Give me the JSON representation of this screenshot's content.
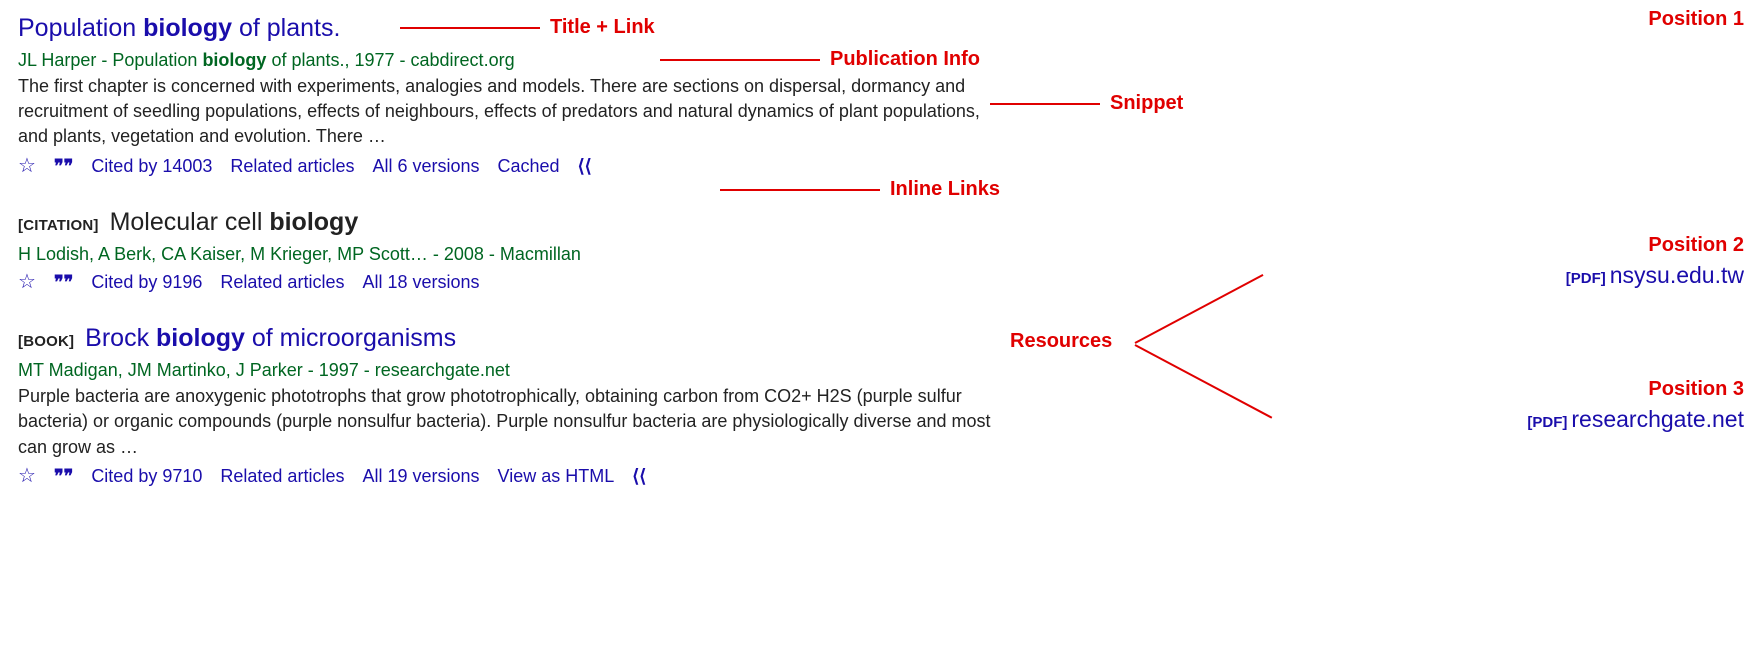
{
  "annotations": {
    "title_link": "Title + Link",
    "pub_info": "Publication Info",
    "snippet": "Snippet",
    "inline_links": "Inline Links",
    "resources": "Resources",
    "pos1": "Position 1",
    "pos2": "Position 2",
    "pos3": "Position 3"
  },
  "results": [
    {
      "title_pre": "Population ",
      "title_bold": "biology",
      "title_post": " of plants.",
      "pub_pre": "JL Harper - Population ",
      "pub_bold": "biology",
      "pub_post": " of plants., 1977 - cabdirect.org",
      "snippet": "The first chapter is concerned with experiments, analogies and models. There are sections on dispersal, dormancy and recruitment of seedling populations, effects of neighbours, effects of predators and natural dynamics of plant populations, and plants, vegetation and evolution. There …",
      "cited_by": "Cited by 14003",
      "related": "Related articles",
      "versions": "All 6 versions",
      "extra1": "Cached"
    },
    {
      "tag": "CITATION",
      "plain_title_pre": "Molecular cell ",
      "plain_title_bold": "biology",
      "pub": "H Lodish, A Berk, CA Kaiser, M Krieger, MP Scott… - 2008 - Macmillan",
      "cited_by": "Cited by 9196",
      "related": "Related articles",
      "versions": "All 18 versions",
      "resource_tag": "PDF",
      "resource_domain": "nsysu.edu.tw"
    },
    {
      "tag": "BOOK",
      "title_pre": "Brock ",
      "title_bold": "biology",
      "title_post": " of microorganisms",
      "pub": "MT Madigan, JM Martinko, J Parker - 1997 - researchgate.net",
      "snippet": "Purple bacteria are anoxygenic phototrophs that grow phototrophically, obtaining carbon from CO2+ H2S (purple sulfur bacteria) or organic compounds (purple nonsulfur bacteria). Purple nonsulfur bacteria are physiologically diverse and most can grow as …",
      "cited_by": "Cited by 9710",
      "related": "Related articles",
      "versions": "All 19 versions",
      "extra1": "View as HTML",
      "resource_tag": "PDF",
      "resource_domain": "researchgate.net"
    }
  ]
}
